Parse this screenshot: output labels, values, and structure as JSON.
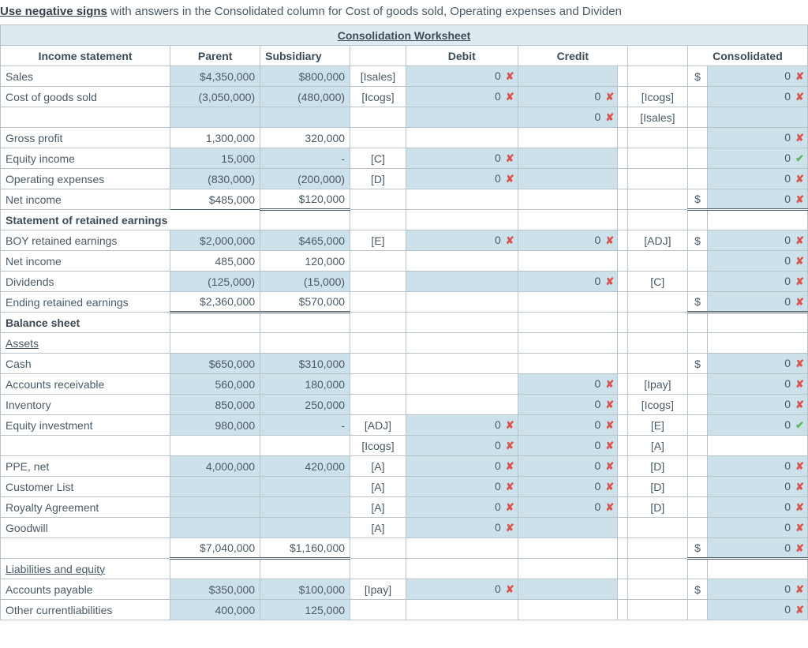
{
  "instruction": {
    "underline": "Use negative signs",
    "rest": " with answers in the Consolidated column for Cost of goods sold, Operating expenses and Dividen"
  },
  "title": "Consolidation Worksheet",
  "headers": {
    "c0": "Income statement",
    "c1": "Parent",
    "c2": "Subsidiary",
    "c3": "",
    "c4": "Debit",
    "c5": "Credit",
    "c6": "",
    "c7": "",
    "c8": "Consolidated"
  },
  "rows": {
    "sales": {
      "label": "Sales",
      "par": "$4,350,000",
      "sub": "$800,000",
      "ref1": "[Isales]",
      "deb": "0",
      "dmark": "x",
      "cred": "",
      "cmark": "",
      "ref2": "",
      "dol": "$",
      "con": "0",
      "kmark": "x"
    },
    "cogs": {
      "label": "Cost of goods sold",
      "par": "(3,050,000)",
      "sub": "(480,000)",
      "ref1": "[Icogs]",
      "deb": "0",
      "dmark": "x",
      "cred": "0",
      "cmark": "x",
      "ref2": "[Icogs]",
      "dol": "",
      "con": "0",
      "kmark": "x"
    },
    "blank1": {
      "label": "",
      "par": "",
      "sub": "",
      "ref1": "",
      "deb": "",
      "dmark": "",
      "cred": "0",
      "cmark": "x",
      "ref2": "[Isales]",
      "dol": "",
      "con": "",
      "kmark": ""
    },
    "gross": {
      "label": "Gross profit",
      "par": "1,300,000",
      "sub": "320,000",
      "ref1": "",
      "deb": "",
      "dmark": "",
      "cred": "",
      "cmark": "",
      "ref2": "",
      "dol": "",
      "con": "0",
      "kmark": "x"
    },
    "eqinc": {
      "label": "Equity income",
      "par": "15,000",
      "sub": "-",
      "ref1": "[C]",
      "deb": "0",
      "dmark": "x",
      "cred": "",
      "cmark": "",
      "ref2": "",
      "dol": "",
      "con": "0",
      "kmark": "ok"
    },
    "opex": {
      "label": "Operating expenses",
      "par": "(830,000)",
      "sub": "(200,000)",
      "ref1": "[D]",
      "deb": "0",
      "dmark": "x",
      "cred": "",
      "cmark": "",
      "ref2": "",
      "dol": "",
      "con": "0",
      "kmark": "x"
    },
    "netinc": {
      "label": "Net income",
      "par": "$485,000",
      "sub": "$120,000",
      "ref1": "",
      "deb": "",
      "dmark": "",
      "cred": "",
      "cmark": "",
      "ref2": "",
      "dol": "$",
      "con": "0",
      "kmark": "x"
    },
    "sre": {
      "label": "Statement of retained earnings"
    },
    "boyre": {
      "label": "BOY retained earnings",
      "par": "$2,000,000",
      "sub": "$465,000",
      "ref1": "[E]",
      "deb": "0",
      "dmark": "x",
      "cred": "0",
      "cmark": "x",
      "ref2": "[ADJ]",
      "dol": "$",
      "con": "0",
      "kmark": "x"
    },
    "netinc2": {
      "label": "Net income",
      "par": "485,000",
      "sub": "120,000",
      "ref1": "",
      "deb": "",
      "dmark": "",
      "cred": "",
      "cmark": "",
      "ref2": "",
      "dol": "",
      "con": "0",
      "kmark": "x"
    },
    "div": {
      "label": "Dividends",
      "par": "(125,000)",
      "sub": "(15,000)",
      "ref1": "",
      "deb": "",
      "dmark": "",
      "cred": "0",
      "cmark": "x",
      "ref2": "[C]",
      "dol": "",
      "con": "0",
      "kmark": "x"
    },
    "ere": {
      "label": "Ending retained earnings",
      "par": "$2,360,000",
      "sub": "$570,000",
      "ref1": "",
      "deb": "",
      "dmark": "",
      "cred": "",
      "cmark": "",
      "ref2": "",
      "dol": "$",
      "con": "0",
      "kmark": "x"
    },
    "bs": {
      "label": "Balance sheet"
    },
    "assets": {
      "label": "Assets"
    },
    "cash": {
      "label": "Cash",
      "par": "$650,000",
      "sub": "$310,000",
      "ref1": "",
      "deb": "",
      "dmark": "",
      "cred": "",
      "cmark": "",
      "ref2": "",
      "dol": "$",
      "con": "0",
      "kmark": "x"
    },
    "ar": {
      "label": "Accounts receivable",
      "par": "560,000",
      "sub": "180,000",
      "ref1": "",
      "deb": "",
      "dmark": "",
      "cred": "0",
      "cmark": "x",
      "ref2": "[Ipay]",
      "dol": "",
      "con": "0",
      "kmark": "x"
    },
    "inv": {
      "label": "Inventory",
      "par": "850,000",
      "sub": "250,000",
      "ref1": "",
      "deb": "",
      "dmark": "",
      "cred": "0",
      "cmark": "x",
      "ref2": "[Icogs]",
      "dol": "",
      "con": "0",
      "kmark": "x"
    },
    "eqinv": {
      "label": "Equity investment",
      "par": "980,000",
      "sub": "-",
      "ref1": "[ADJ]",
      "deb": "0",
      "dmark": "x",
      "cred": "0",
      "cmark": "x",
      "ref2": "[E]",
      "dol": "",
      "con": "0",
      "kmark": "ok"
    },
    "eqinv2": {
      "label": "",
      "par": "",
      "sub": "",
      "ref1": "[Icogs]",
      "deb": "0",
      "dmark": "x",
      "cred": "0",
      "cmark": "x",
      "ref2": "[A]",
      "dol": "",
      "con": "",
      "kmark": ""
    },
    "ppe": {
      "label": "PPE, net",
      "par": "4,000,000",
      "sub": "420,000",
      "ref1": "[A]",
      "deb": "0",
      "dmark": "x",
      "cred": "0",
      "cmark": "x",
      "ref2": "[D]",
      "dol": "",
      "con": "0",
      "kmark": "x"
    },
    "cust": {
      "label": "Customer List",
      "par": "",
      "sub": "",
      "ref1": "[A]",
      "deb": "0",
      "dmark": "x",
      "cred": "0",
      "cmark": "x",
      "ref2": "[D]",
      "dol": "",
      "con": "0",
      "kmark": "x"
    },
    "roy": {
      "label": "Royalty Agreement",
      "par": "",
      "sub": "",
      "ref1": "[A]",
      "deb": "0",
      "dmark": "x",
      "cred": "0",
      "cmark": "x",
      "ref2": "[D]",
      "dol": "",
      "con": "0",
      "kmark": "x"
    },
    "gw": {
      "label": "Goodwill",
      "par": "",
      "sub": "",
      "ref1": "[A]",
      "deb": "0",
      "dmark": "x",
      "cred": "",
      "cmark": "",
      "ref2": "",
      "dol": "",
      "con": "0",
      "kmark": "x"
    },
    "tot": {
      "label": "",
      "par": "$7,040,000",
      "sub": "$1,160,000",
      "ref1": "",
      "deb": "",
      "dmark": "",
      "cred": "",
      "cmark": "",
      "ref2": "",
      "dol": "$",
      "con": "0",
      "kmark": "x"
    },
    "liab": {
      "label": "Liabilities and equity"
    },
    "ap": {
      "label": "Accounts payable",
      "par": "$350,000",
      "sub": "$100,000",
      "ref1": "[Ipay]",
      "deb": "0",
      "dmark": "x",
      "cred": "",
      "cmark": "",
      "ref2": "",
      "dol": "$",
      "con": "0",
      "kmark": "x"
    },
    "ocl": {
      "label": "Other currentliabilities",
      "par": "400,000",
      "sub": "125,000",
      "ref1": "",
      "deb": "",
      "dmark": "",
      "cred": "",
      "cmark": "",
      "ref2": "",
      "dol": "",
      "con": "0",
      "kmark": "x"
    }
  }
}
